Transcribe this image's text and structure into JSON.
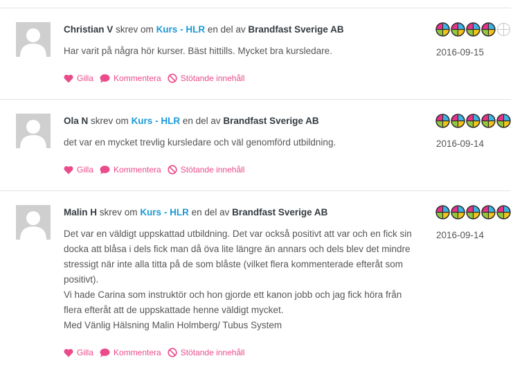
{
  "common": {
    "wrote_about": "skrev om",
    "part_of": "en del av",
    "like_label": "Gilla",
    "comment_label": "Kommentera",
    "report_label": "Stötande innehåll",
    "colors": {
      "accent_pink": "#ea4b8a",
      "link_blue": "#1a9ad6",
      "divider": "#e3e3e3"
    },
    "icons": {
      "like": "heart-icon",
      "comment": "comment-bubble-icon",
      "report": "prohibited-icon",
      "rating": "rating-segment-icon"
    }
  },
  "reviews": [
    {
      "author": "Christian V",
      "course": "Kurs - HLR",
      "company": "Brandfast Sverige AB",
      "date": "2016-09-15",
      "rating": 4,
      "rating_max": 5,
      "lines": [
        "Har varit på några hör kurser. Bäst hittills. Mycket bra kursledare."
      ]
    },
    {
      "author": "Ola N",
      "course": "Kurs - HLR",
      "company": "Brandfast Sverige AB",
      "date": "2016-09-14",
      "rating": 5,
      "rating_max": 5,
      "lines": [
        "det var en mycket trevlig kursledare och väl genomförd utbildning."
      ]
    },
    {
      "author": "Malin H",
      "course": "Kurs - HLR",
      "company": "Brandfast Sverige AB",
      "date": "2016-09-14",
      "rating": 5,
      "rating_max": 5,
      "lines": [
        "Det var en väldigt uppskattad utbildning. Det var också positivt att var och en fick sin",
        "docka att blåsa i dels fick man då öva lite längre än annars och dels blev det mindre",
        "stressigt när inte alla titta på de som blåste (vilket flera kommenterade efteråt som",
        "positivt).",
        "Vi hade Carina som instruktör och hon gjorde ett kanon jobb och jag fick höra från",
        "flera efteråt att de uppskattade henne väldigt mycket.",
        "Med Vänlig Hälsning Malin Holmberg/ Tubus System"
      ]
    }
  ]
}
